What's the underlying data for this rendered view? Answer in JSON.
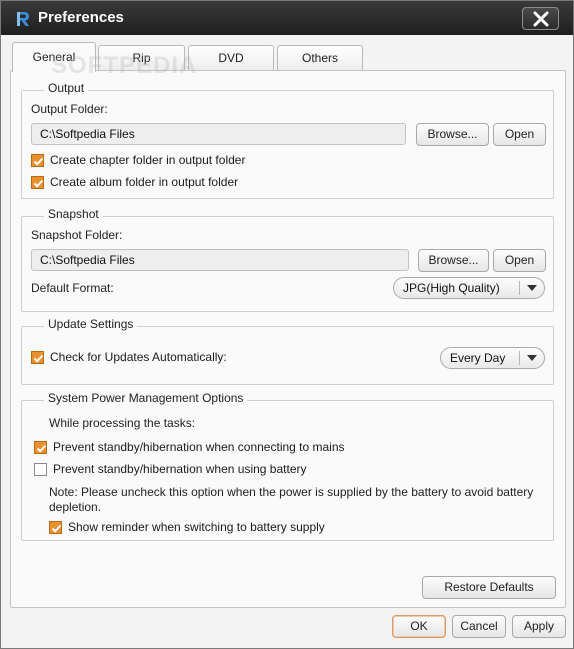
{
  "window": {
    "title": "Preferences",
    "watermark": "SOFTPEDIA"
  },
  "tabs": [
    {
      "label": "General",
      "active": true
    },
    {
      "label": "Rip",
      "active": false
    },
    {
      "label": "DVD",
      "active": false
    },
    {
      "label": "Others",
      "active": false
    }
  ],
  "output": {
    "legend": "Output",
    "folder_label": "Output Folder:",
    "folder_value": "C:\\Softpedia Files",
    "browse_label": "Browse...",
    "open_label": "Open",
    "chapter_folder": {
      "label": "Create chapter folder in output folder",
      "checked": true
    },
    "album_folder": {
      "label": "Create album folder in output folder",
      "checked": true
    }
  },
  "snapshot": {
    "legend": "Snapshot",
    "folder_label": "Snapshot Folder:",
    "folder_value": "C:\\Softpedia Files",
    "browse_label": "Browse...",
    "open_label": "Open",
    "format_label": "Default Format:",
    "format_value": "JPG(High Quality)"
  },
  "update": {
    "legend": "Update Settings",
    "auto_check": {
      "label": "Check for Updates Automatically:",
      "checked": true
    },
    "frequency_value": "Every Day"
  },
  "power": {
    "legend": "System Power Management Options",
    "intro": "While processing the tasks:",
    "prevent_mains": {
      "label": "Prevent standby/hibernation when connecting to mains",
      "checked": true
    },
    "prevent_battery": {
      "label": "Prevent standby/hibernation when using battery",
      "checked": false
    },
    "note_line1": "Note: Please uncheck this option when the power is supplied by the battery to avoid battery",
    "note_line2": "depletion.",
    "reminder": {
      "label": "Show reminder when switching to battery supply",
      "checked": true
    }
  },
  "buttons": {
    "restore_defaults": "Restore Defaults",
    "ok": "OK",
    "cancel": "Cancel",
    "apply": "Apply"
  },
  "colors": {
    "titlebar": "#262626",
    "checkbox_checked": "#e9912f",
    "ok_focus_border": "#d99a6a"
  },
  "icons": {
    "app_logo": "app-logo-icon",
    "close": "close-icon",
    "checkmark": "checkmark-icon",
    "dropdown_arrow": "triangle-down-icon"
  }
}
